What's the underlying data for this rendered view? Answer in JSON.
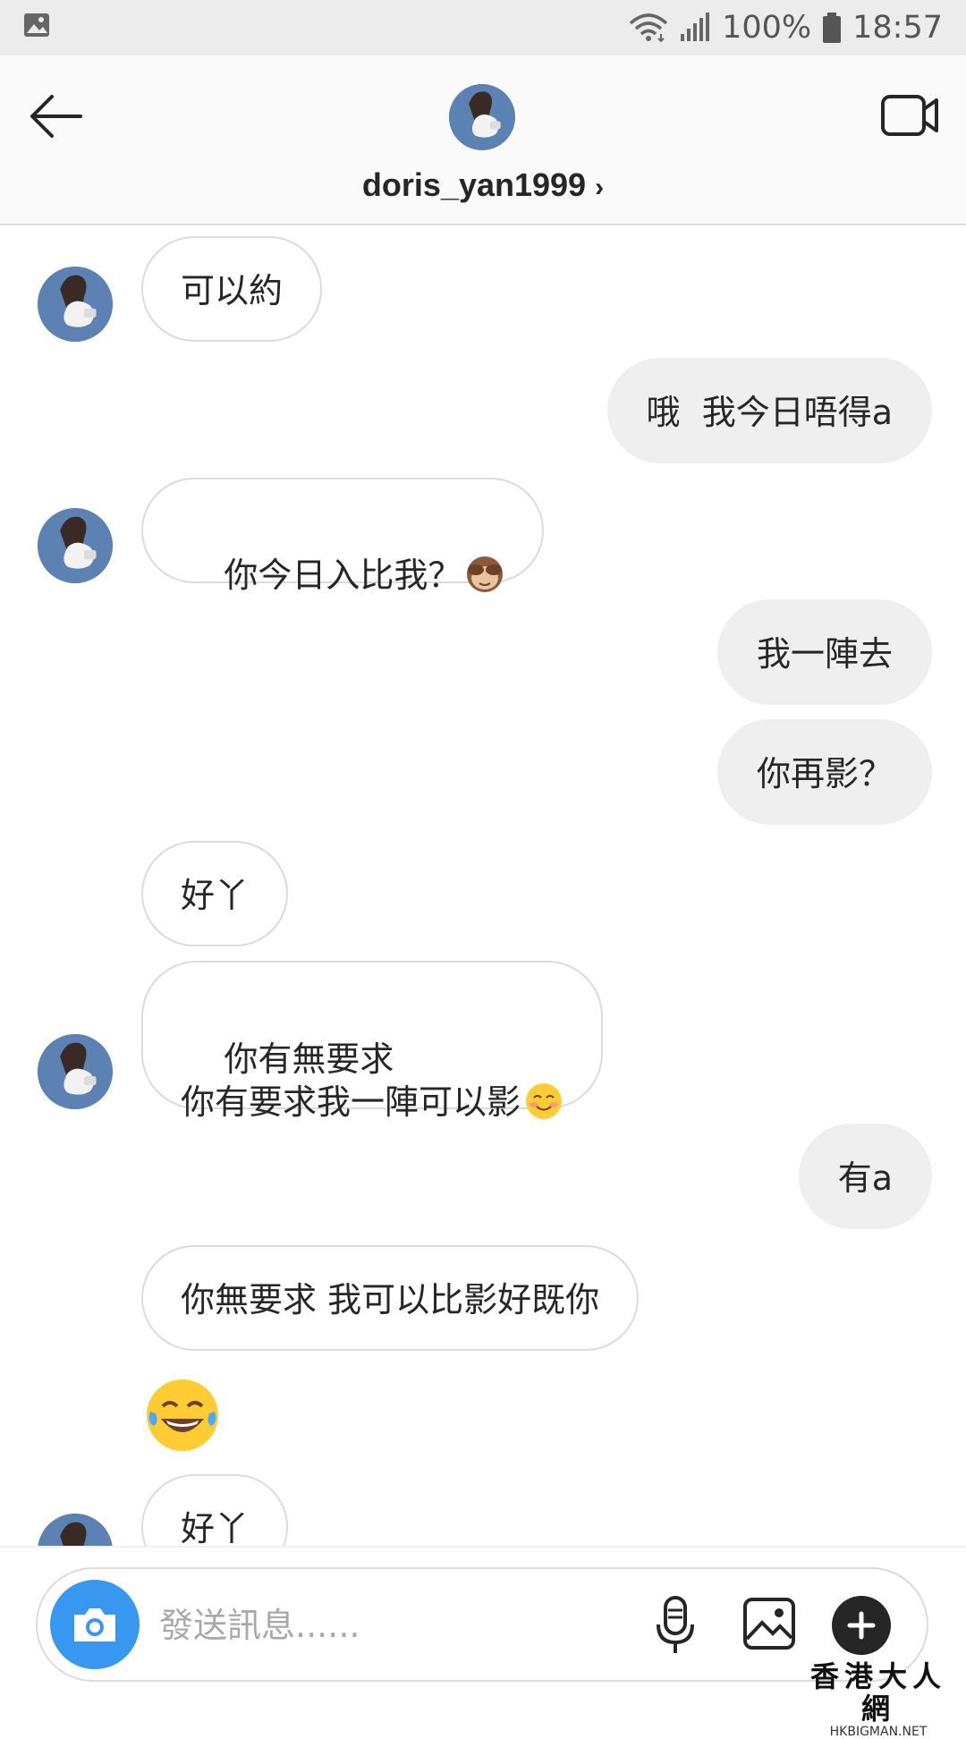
{
  "status_bar": {
    "battery": "100%",
    "time": "18:57"
  },
  "header": {
    "username": "doris_yan1999",
    "chevron": "›"
  },
  "messages": [
    {
      "text": "可以約"
    },
    {
      "text": "哦  我今日唔得a"
    },
    {
      "text": "你今日入比我？"
    },
    {
      "text": "我一陣去"
    },
    {
      "text": "你再影？"
    },
    {
      "text": "好丫"
    },
    {
      "text": "你有無要求\n你有要求我一陣可以影"
    },
    {
      "text": "有a"
    },
    {
      "text": "你無要求 我可以比影好既你"
    },
    {
      "text": "好丫"
    }
  ],
  "icons": {
    "status": [
      "gallery-icon",
      "wifi-icon",
      "signal-icon",
      "battery-icon"
    ],
    "header": [
      "back-arrow-icon",
      "avatar",
      "video-call-icon"
    ],
    "composer": [
      "camera-icon",
      "microphone-icon",
      "gallery-icon",
      "plus-icon"
    ],
    "emojis": [
      "see-no-evil-monkey-emoji",
      "smiling-blush-emoji",
      "tears-of-joy-emoji"
    ]
  },
  "composer": {
    "placeholder": "發送訊息......"
  },
  "watermark": {
    "title": "香港大人網",
    "subtitle": "HKBIGMAN.NET"
  },
  "colors": {
    "accent": "#3897f0",
    "incoming_border": "#dbdbdb",
    "outgoing_bg": "#efefef"
  }
}
